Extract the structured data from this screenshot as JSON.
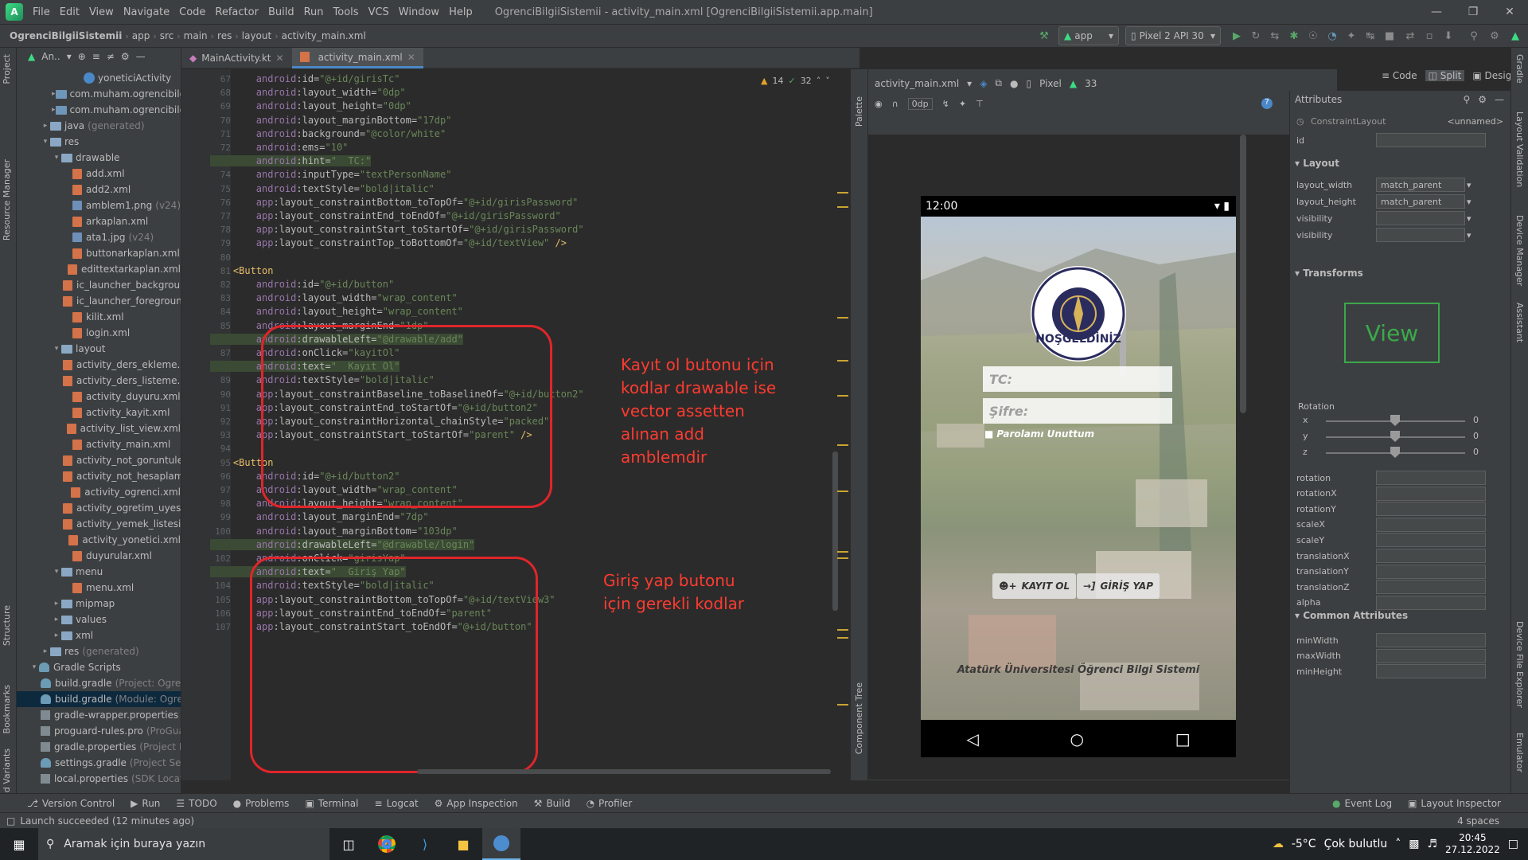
{
  "window": {
    "title": "OgrenciBilgiiSistemii - activity_main.xml [OgrenciBilgiiSistemii.app.main]",
    "menu": [
      "File",
      "Edit",
      "View",
      "Navigate",
      "Code",
      "Refactor",
      "Build",
      "Run",
      "Tools",
      "VCS",
      "Window",
      "Help"
    ]
  },
  "breadcrumb": [
    "OgrenciBilgiiSistemii",
    "app",
    "src",
    "main",
    "res",
    "layout",
    "activity_main.xml"
  ],
  "toolbar": {
    "run_config": "app",
    "device": "Pixel 2 API 30"
  },
  "project": {
    "header": "An..",
    "rows": [
      {
        "label": "yoneticiActivity",
        "depth": 3,
        "icon": "class"
      },
      {
        "label": "com.muham.ogrencibilgiisist",
        "depth": 1,
        "icon": "package",
        "arrow": "right"
      },
      {
        "label": "com.muham.ogrencibilgiisist",
        "depth": 1,
        "icon": "package",
        "arrow": "right"
      },
      {
        "label": "java",
        "extra": "(generated)",
        "depth": 0,
        "icon": "folder",
        "arrow": "right"
      },
      {
        "label": "res",
        "depth": 0,
        "icon": "folder",
        "arrow": "down"
      },
      {
        "label": "drawable",
        "depth": 1,
        "icon": "folder",
        "arrow": "down"
      },
      {
        "label": "add.xml",
        "depth": 2,
        "icon": "xml"
      },
      {
        "label": "add2.xml",
        "depth": 2,
        "icon": "xml"
      },
      {
        "label": "amblem1.png",
        "extra": "(v24)",
        "depth": 2,
        "icon": "img"
      },
      {
        "label": "arkaplan.xml",
        "depth": 2,
        "icon": "xml"
      },
      {
        "label": "ata1.jpg",
        "extra": "(v24)",
        "depth": 2,
        "icon": "img"
      },
      {
        "label": "buttonarkaplan.xml",
        "depth": 2,
        "icon": "xml"
      },
      {
        "label": "edittextarkaplan.xml",
        "depth": 2,
        "icon": "xml"
      },
      {
        "label": "ic_launcher_background.x",
        "depth": 2,
        "icon": "xml"
      },
      {
        "label": "ic_launcher_foreground.x",
        "depth": 2,
        "icon": "xml"
      },
      {
        "label": "kilit.xml",
        "depth": 2,
        "icon": "xml"
      },
      {
        "label": "login.xml",
        "depth": 2,
        "icon": "xml"
      },
      {
        "label": "layout",
        "depth": 1,
        "icon": "folder",
        "arrow": "down"
      },
      {
        "label": "activity_ders_ekleme.xml",
        "depth": 2,
        "icon": "xml"
      },
      {
        "label": "activity_ders_listeme.xml",
        "depth": 2,
        "icon": "xml"
      },
      {
        "label": "activity_duyuru.xml",
        "depth": 2,
        "icon": "xml"
      },
      {
        "label": "activity_kayit.xml",
        "depth": 2,
        "icon": "xml"
      },
      {
        "label": "activity_list_view.xml",
        "depth": 2,
        "icon": "xml"
      },
      {
        "label": "activity_main.xml",
        "depth": 2,
        "icon": "xml"
      },
      {
        "label": "activity_not_goruntuleme",
        "depth": 2,
        "icon": "xml"
      },
      {
        "label": "activity_not_hesaplama.x",
        "depth": 2,
        "icon": "xml"
      },
      {
        "label": "activity_ogrenci.xml",
        "depth": 2,
        "icon": "xml"
      },
      {
        "label": "activity_ogretim_uyesi.xm",
        "depth": 2,
        "icon": "xml"
      },
      {
        "label": "activity_yemek_listesi.xml",
        "depth": 2,
        "icon": "xml"
      },
      {
        "label": "activity_yonetici.xml",
        "depth": 2,
        "icon": "xml"
      },
      {
        "label": "duyurular.xml",
        "depth": 2,
        "icon": "xml"
      },
      {
        "label": "menu",
        "depth": 1,
        "icon": "folder",
        "arrow": "down"
      },
      {
        "label": "menu.xml",
        "depth": 2,
        "icon": "xml"
      },
      {
        "label": "mipmap",
        "depth": 1,
        "icon": "folder",
        "arrow": "right"
      },
      {
        "label": "values",
        "depth": 1,
        "icon": "folder",
        "arrow": "right"
      },
      {
        "label": "xml",
        "depth": 1,
        "icon": "folder",
        "arrow": "right"
      },
      {
        "label": "res",
        "extra": "(generated)",
        "depth": 0,
        "icon": "folder",
        "arrow": "right"
      },
      {
        "label": "Gradle Scripts",
        "depth": -1,
        "icon": "gradle",
        "arrow": "down"
      },
      {
        "label": "build.gradle",
        "extra": "(Project: OgrenciBil",
        "depth": 0,
        "icon": "gradle"
      },
      {
        "label": "build.gradle",
        "extra": "(Module: OgrenciBil",
        "depth": 0,
        "icon": "gradle",
        "selected": true
      },
      {
        "label": "gradle-wrapper.properties",
        "extra": "(Grad",
        "depth": 0,
        "icon": "prop"
      },
      {
        "label": "proguard-rules.pro",
        "extra": "(ProGuard R",
        "depth": 0,
        "icon": "prop"
      },
      {
        "label": "gradle.properties",
        "extra": "(Project Proper",
        "depth": 0,
        "icon": "prop"
      },
      {
        "label": "settings.gradle",
        "extra": "(Project Setting",
        "depth": 0,
        "icon": "gradle"
      },
      {
        "label": "local.properties",
        "extra": "(SDK Location)",
        "depth": 0,
        "icon": "prop"
      }
    ]
  },
  "tabs": [
    {
      "label": "MainActivity.kt"
    },
    {
      "label": "activity_main.xml",
      "active": true
    }
  ],
  "editor": {
    "inspection": {
      "warnings": "14",
      "weak": "32"
    },
    "lines": [
      {
        "n": "67",
        "t": "        android:id=\"@+id/girisTc\""
      },
      {
        "n": "68",
        "t": "        android:layout_width=\"0dp\""
      },
      {
        "n": "69",
        "t": "        android:layout_height=\"0dp\""
      },
      {
        "n": "70",
        "t": "        android:layout_marginBottom=\"17dp\""
      },
      {
        "n": "71",
        "t": "        android:background=\"@color/white\""
      },
      {
        "n": "72",
        "t": "        android:ems=\"10\""
      },
      {
        "n": "73",
        "t": "        android:hint=\"  TC:\"",
        "hl": true
      },
      {
        "n": "74",
        "t": "        android:inputType=\"textPersonName\""
      },
      {
        "n": "75",
        "t": "        android:textStyle=\"bold|italic\""
      },
      {
        "n": "76",
        "t": "        app:layout_constraintBottom_toTopOf=\"@+id/girisPassword\""
      },
      {
        "n": "77",
        "t": "        app:layout_constraintEnd_toEndOf=\"@+id/girisPassword\""
      },
      {
        "n": "78",
        "t": "        app:layout_constraintStart_toStartOf=\"@+id/girisPassword\""
      },
      {
        "n": "79",
        "t": "        app:layout_constraintTop_toBottomOf=\"@+id/textView\" />"
      },
      {
        "n": "80",
        "t": ""
      },
      {
        "n": "81",
        "t": "    <Button"
      },
      {
        "n": "82",
        "t": "        android:id=\"@+id/button\""
      },
      {
        "n": "83",
        "t": "        android:layout_width=\"wrap_content\""
      },
      {
        "n": "84",
        "t": "        android:layout_height=\"wrap_content\""
      },
      {
        "n": "85",
        "t": "        android:layout_marginEnd=\"1dp\""
      },
      {
        "n": "86",
        "t": "        android:drawableLeft=\"@drawable/add\"",
        "hl": true
      },
      {
        "n": "87",
        "t": "        android:onClick=\"kayitOl\""
      },
      {
        "n": "88",
        "t": "        android:text=\"  Kayıt Ol\"",
        "hl": true
      },
      {
        "n": "89",
        "t": "        android:textStyle=\"bold|italic\""
      },
      {
        "n": "90",
        "t": "        app:layout_constraintBaseline_toBaselineOf=\"@+id/button2\""
      },
      {
        "n": "91",
        "t": "        app:layout_constraintEnd_toStartOf=\"@+id/button2\""
      },
      {
        "n": "92",
        "t": "        app:layout_constraintHorizontal_chainStyle=\"packed\""
      },
      {
        "n": "93",
        "t": "        app:layout_constraintStart_toStartOf=\"parent\" />"
      },
      {
        "n": "94",
        "t": ""
      },
      {
        "n": "95",
        "t": "    <Button"
      },
      {
        "n": "96",
        "t": "        android:id=\"@+id/button2\""
      },
      {
        "n": "97",
        "t": "        android:layout_width=\"wrap_content\""
      },
      {
        "n": "98",
        "t": "        android:layout_height=\"wrap_content\""
      },
      {
        "n": "99",
        "t": "        android:layout_marginEnd=\"7dp\""
      },
      {
        "n": "100",
        "t": "        android:layout_marginBottom=\"103dp\""
      },
      {
        "n": "101",
        "t": "        android:drawableLeft=\"@drawable/login\"",
        "hl": true
      },
      {
        "n": "102",
        "t": "        android:onClick=\"girisYap\""
      },
      {
        "n": "103",
        "t": "        android:text=\"  Giriş Yap\"",
        "hl": true
      },
      {
        "n": "104",
        "t": "        android:textStyle=\"bold|italic\""
      },
      {
        "n": "105",
        "t": "        app:layout_constraintBottom_toTopOf=\"@+id/textView3\""
      },
      {
        "n": "106",
        "t": "        app:layout_constraintEnd_toEndOf=\"parent\""
      },
      {
        "n": "107",
        "t": "        app:layout_constraintStart_toEndOf=\"@+id/button\""
      }
    ]
  },
  "annotations": {
    "note1": "Kayıt ol butonu için\nkodlar drawable ise\nvector assetten\nalınan add\namblemdir",
    "note2": "Giriş yap butonu\niçin gerekli kodlar"
  },
  "design": {
    "mode": [
      "Code",
      "Split",
      "Design"
    ],
    "file": "activity_main.xml",
    "device": "Pixel",
    "api": "33",
    "margin": "0dp",
    "phone": {
      "time": "12:00",
      "welcome": "HOŞGELDİNİZ",
      "tc_hint": "TC:",
      "password_hint": "Şifre:",
      "forgot": "Parolamı Unuttum",
      "register_button": "KAYIT OL",
      "login_button": "GİRİŞ YAP",
      "footer": "Atatürk Üniversitesi Öğrenci Bilgi Sistemi",
      "seal_top": "Atatürk Üniversitesi",
      "seal_bottom": "Atatürk University"
    }
  },
  "attributes": {
    "title": "Attributes",
    "component": "ConstraintLayout",
    "unnamed": "<unnamed>",
    "id_label": "id",
    "layout_section": "Layout",
    "layout_rows": [
      {
        "label": "layout_width",
        "value": "match_parent"
      },
      {
        "label": "layout_height",
        "value": "match_parent"
      },
      {
        "label": "visibility",
        "value": ""
      },
      {
        "label": "visibility",
        "value": ""
      }
    ],
    "transforms_section": "Transforms",
    "view_label": "View",
    "rotation_label": "Rotation",
    "axes": [
      {
        "label": "x",
        "value": "0"
      },
      {
        "label": "y",
        "value": "0"
      },
      {
        "label": "z",
        "value": "0"
      }
    ],
    "transform_rows": [
      "rotation",
      "rotationX",
      "rotationY",
      "scaleX",
      "scaleY",
      "translationX",
      "translationY",
      "translationZ",
      "alpha"
    ],
    "common_section": "Common Attributes",
    "common_rows": [
      "minWidth",
      "maxWidth",
      "minHeight"
    ]
  },
  "bottom_tools": [
    "Version Control",
    "Run",
    "TODO",
    "Problems",
    "Terminal",
    "Logcat",
    "App Inspection",
    "Build",
    "Profiler"
  ],
  "bottom_right_tools": [
    "Event Log",
    "Layout Inspector"
  ],
  "status": {
    "message": "Launch succeeded (12 minutes ago)",
    "indent": "4 spaces"
  },
  "left_strip": [
    "Project",
    "Resource Manager",
    "Structure",
    "Bookmarks",
    "Build Variants"
  ],
  "right_strip": [
    "Gradle",
    "Layout Validation",
    "Device Manager",
    "Assistant",
    "Device File Explorer",
    "Emulator"
  ],
  "side_labels": {
    "palette": "Palette",
    "component_tree": "Component Tree"
  },
  "taskbar": {
    "search": "Aramak için buraya yazın",
    "temperature": "-5°C",
    "weather": "Çok bulutlu",
    "time": "20:45",
    "date": "27.12.2022"
  },
  "colors": {
    "accent": "#4a88c7",
    "annotation": "#e0252a"
  }
}
